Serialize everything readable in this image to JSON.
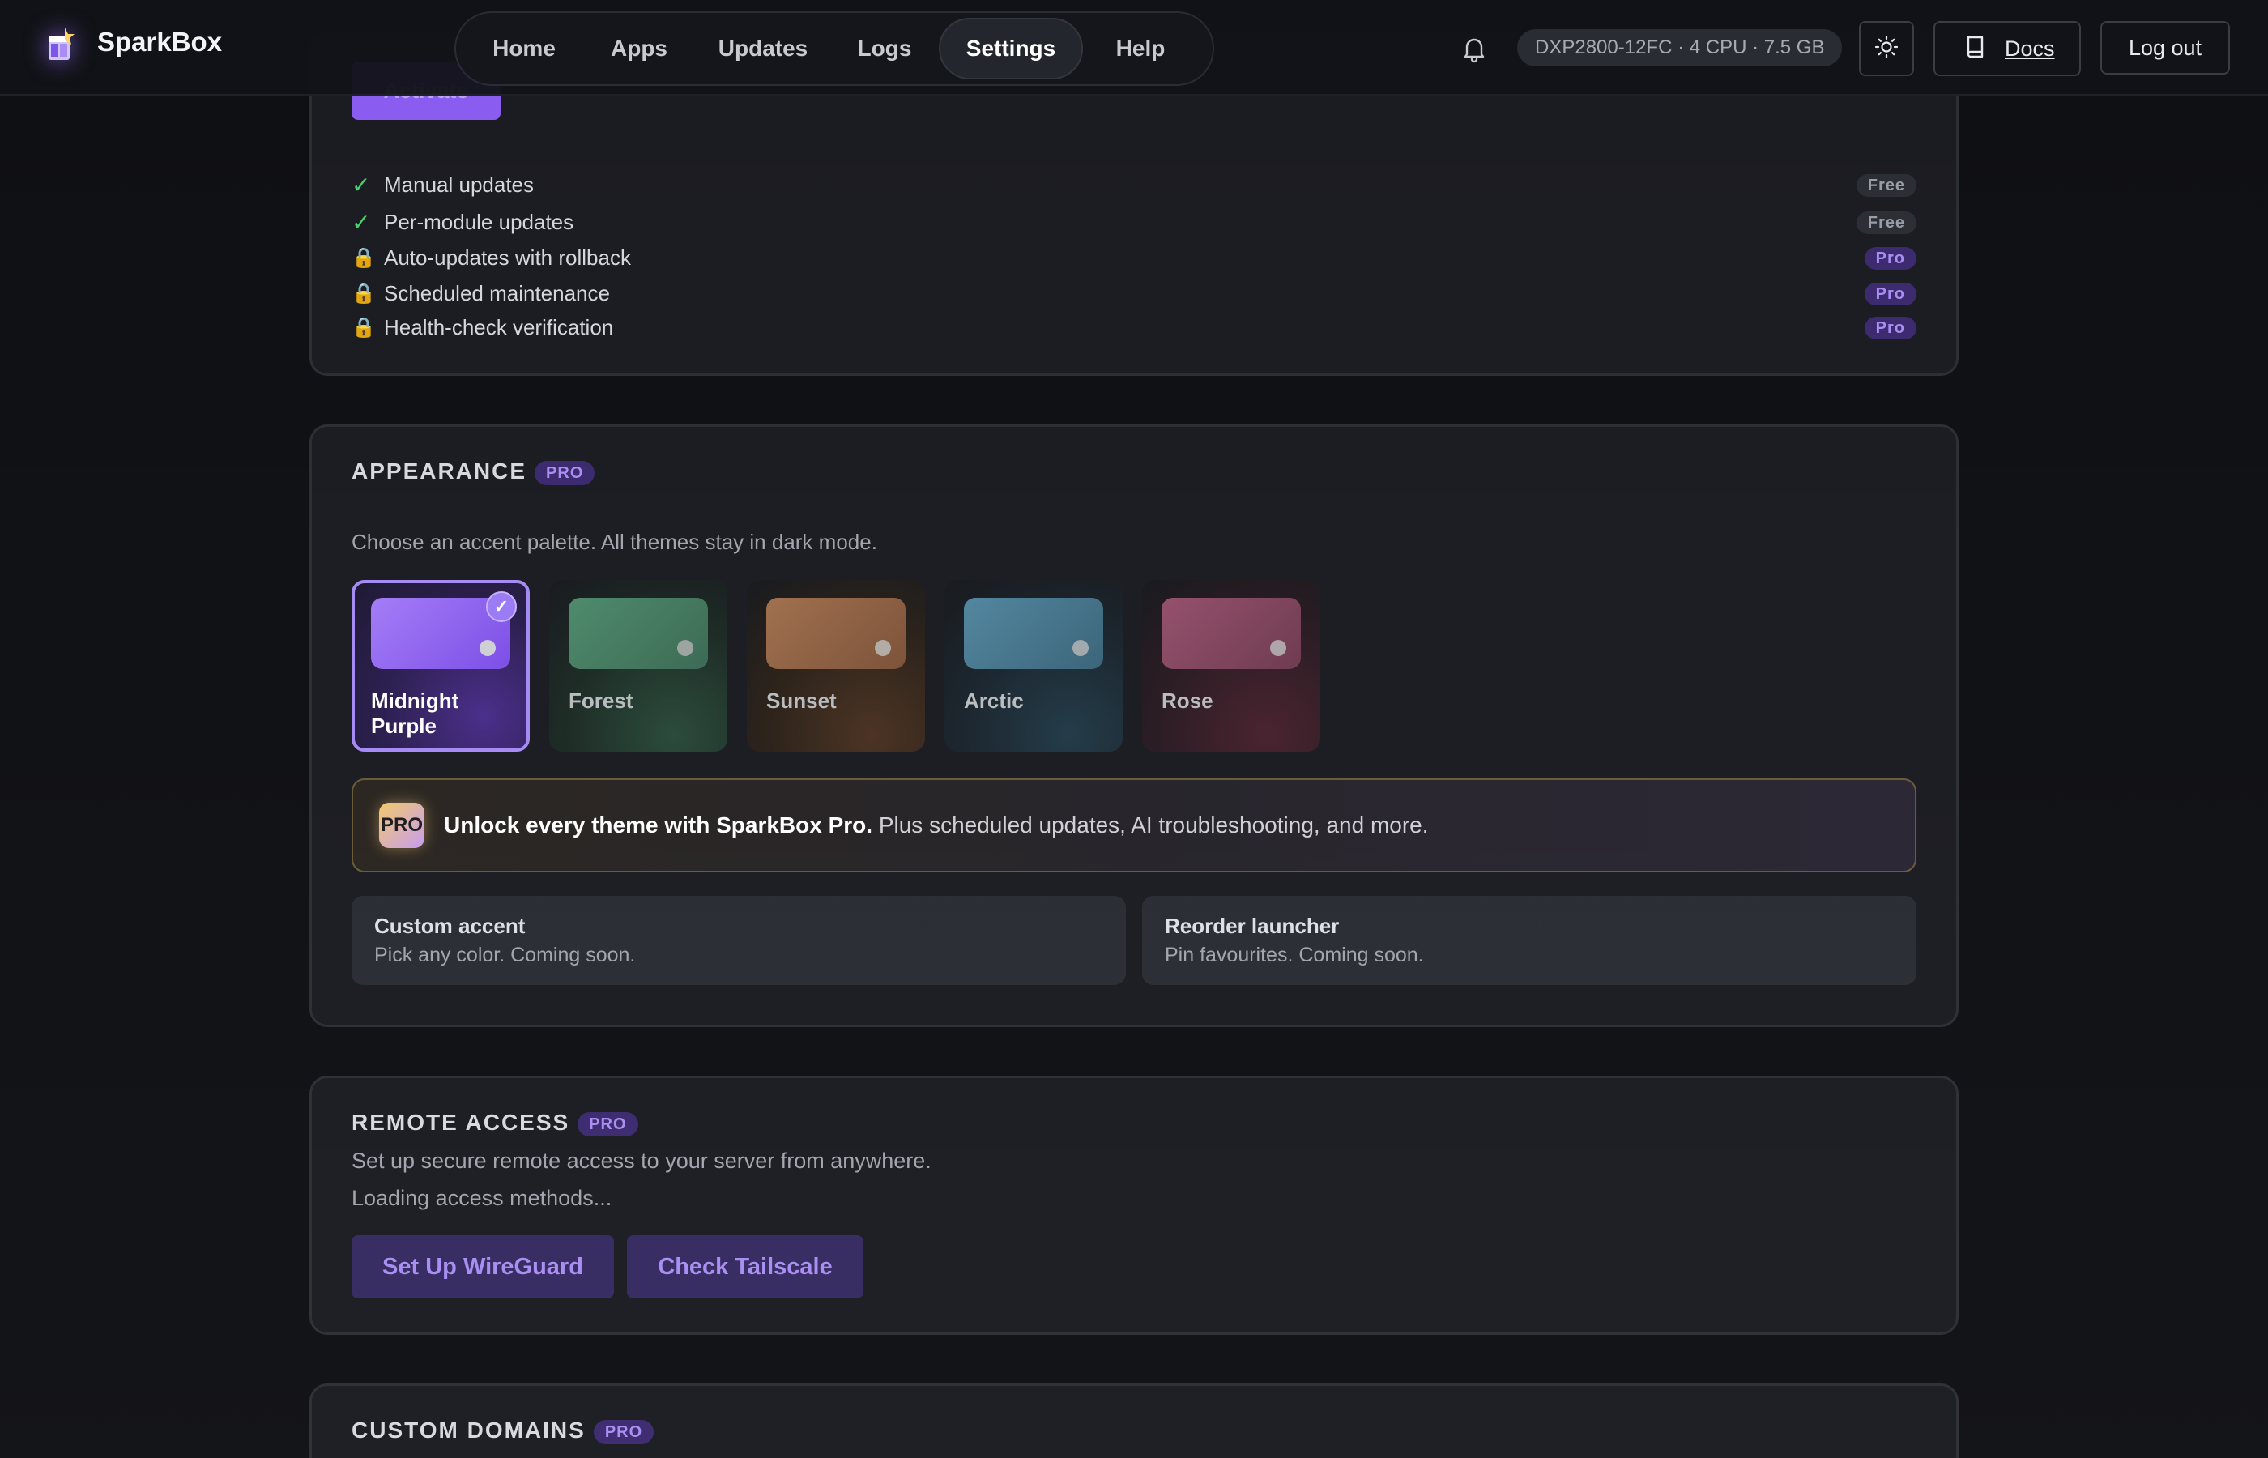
{
  "brand": {
    "name": "SparkBox"
  },
  "nav": {
    "items": [
      {
        "label": "Home",
        "active": false
      },
      {
        "label": "Apps",
        "active": false
      },
      {
        "label": "Updates",
        "active": false
      },
      {
        "label": "Logs",
        "active": false
      },
      {
        "label": "Settings",
        "active": true
      },
      {
        "label": "Help",
        "active": false
      }
    ]
  },
  "header": {
    "system_info": "DXP2800-12FC · 4 CPU · 7.5 GB",
    "docs_label": "Docs",
    "logout_label": "Log out",
    "icons": [
      "bell-icon",
      "sun-icon",
      "book-icon"
    ]
  },
  "updates_card": {
    "activate_label": "Activate",
    "features": [
      {
        "label": "Manual updates",
        "status": "included",
        "badge": "Free"
      },
      {
        "label": "Per-module updates",
        "status": "included",
        "badge": "Free"
      },
      {
        "label": "Auto-updates with rollback",
        "status": "locked",
        "badge": "Pro"
      },
      {
        "label": "Scheduled maintenance",
        "status": "locked",
        "badge": "Pro"
      },
      {
        "label": "Health-check verification",
        "status": "locked",
        "badge": "Pro"
      }
    ]
  },
  "appearance": {
    "title": "APPEARANCE",
    "badge": "PRO",
    "description": "Choose an accent palette. All themes stay in dark mode.",
    "selected_theme": "Midnight Purple",
    "themes": [
      {
        "name": "Midnight Purple",
        "color": "#8b5cf6"
      },
      {
        "name": "Forest",
        "color": "#4e8a6c"
      },
      {
        "name": "Sunset",
        "color": "#a06a4c"
      },
      {
        "name": "Arctic",
        "color": "#4e7e97"
      },
      {
        "name": "Rose",
        "color": "#8a4b66"
      }
    ],
    "promo": {
      "badge": "PRO",
      "headline": "Unlock every theme with SparkBox Pro.",
      "body": " Plus scheduled updates, AI troubleshooting, and more."
    },
    "extras": [
      {
        "title": "Custom accent",
        "subtitle": "Pick any color. Coming soon."
      },
      {
        "title": "Reorder launcher",
        "subtitle": "Pin favourites. Coming soon."
      }
    ]
  },
  "remote_access": {
    "title": "REMOTE ACCESS",
    "badge": "PRO",
    "description": "Set up secure remote access to your server from anywhere.",
    "status": "Loading access methods...",
    "buttons": [
      "Set Up WireGuard",
      "Check Tailscale"
    ]
  },
  "custom_domains": {
    "title": "CUSTOM DOMAINS",
    "badge": "PRO"
  },
  "colors": {
    "background": "#0f1014",
    "card": "#1b1c22",
    "accent": "#8b5cf6",
    "accent_text": "#a98df3",
    "success": "#43d36a"
  }
}
